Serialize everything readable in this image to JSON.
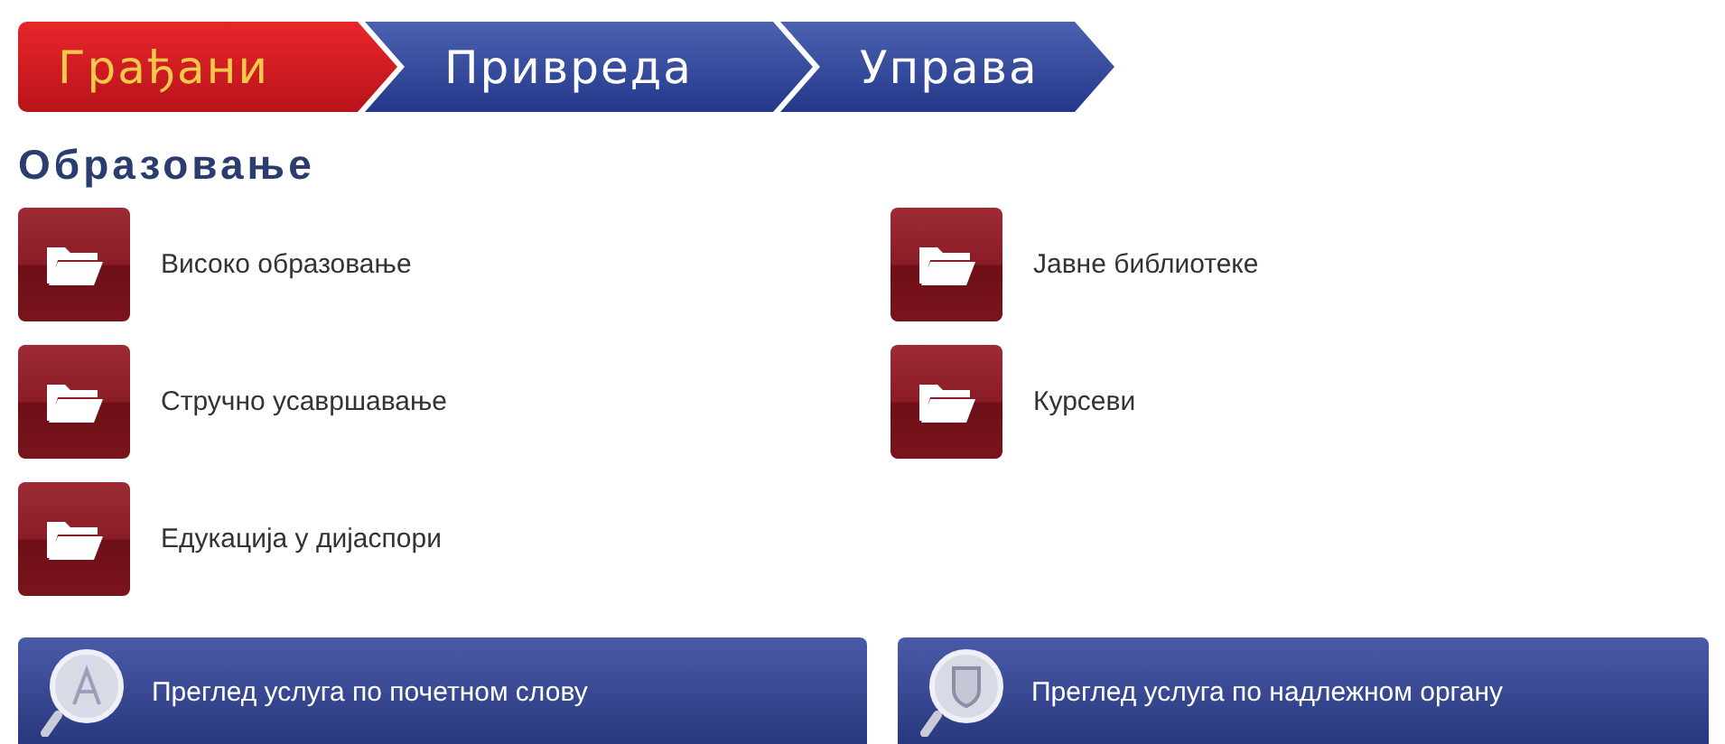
{
  "tabs": [
    {
      "label": "Грађани",
      "selected": true
    },
    {
      "label": "Привреда",
      "selected": false
    },
    {
      "label": "Управа",
      "selected": false
    }
  ],
  "heading": "Образовање",
  "categories": [
    {
      "label": "Високо образовање"
    },
    {
      "label": "Јавне библиотеке"
    },
    {
      "label": "Стручно усавршавање"
    },
    {
      "label": "Курсеви"
    },
    {
      "label": "Едукација у дијаспори"
    }
  ],
  "buttons": [
    {
      "label": "Преглед услуга по почетном слову",
      "kind": "letter"
    },
    {
      "label": "Преглед услуга по надлежном органу",
      "kind": "emblem"
    }
  ]
}
